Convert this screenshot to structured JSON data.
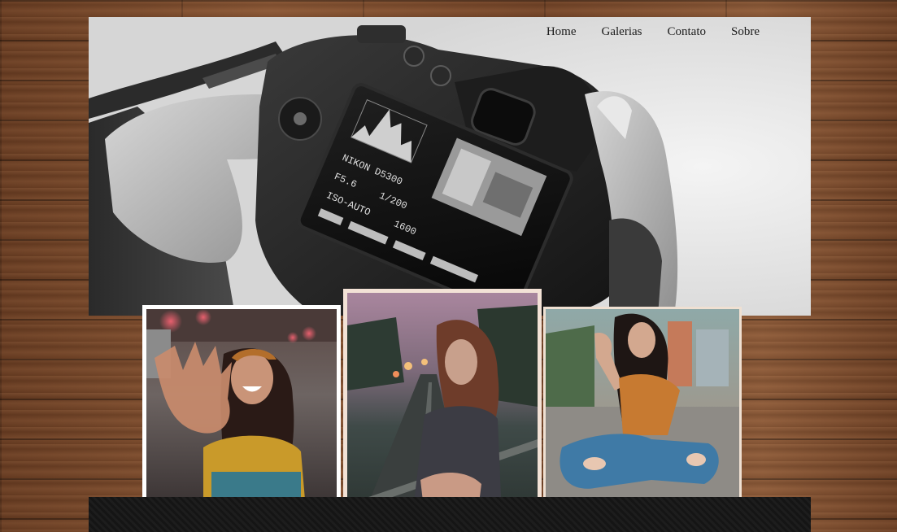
{
  "nav": {
    "home": "Home",
    "galerias": "Galerias",
    "contato": "Contato",
    "sobre": "Sobre"
  },
  "hero": {
    "image": "camera-in-hands-photo"
  },
  "camera_screen": {
    "model": "NIKON D5300",
    "iso_label": "ISO-AUTO",
    "iso_value": "1600",
    "aperture": "F5.6",
    "shutter": "1/200"
  },
  "gallery": [
    {
      "image": "woman-reaching-hand-photo"
    },
    {
      "image": "woman-on-bridge-photo"
    },
    {
      "image": "woman-sitting-street-photo"
    }
  ],
  "colors": {
    "nav_text": "#1c1c1c",
    "frame_white": "#ffffff",
    "footer": "#151515"
  }
}
